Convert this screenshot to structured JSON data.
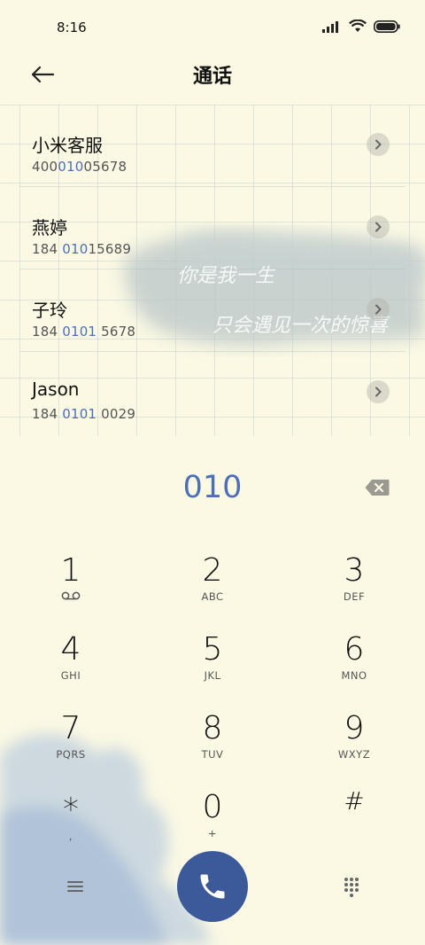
{
  "status_bar": {
    "time": "8:16"
  },
  "header": {
    "title": "通话"
  },
  "contacts": [
    {
      "name": "小米客服",
      "number_pre": "400",
      "number_hl": "010",
      "number_post": "05678"
    },
    {
      "name": "燕婷",
      "number_pre": "184 ",
      "number_hl": "010",
      "number_post": "15689"
    },
    {
      "name": "子玲",
      "number_pre": "184 ",
      "number_hl": "0101",
      "number_post": " 5678"
    },
    {
      "name": "Jason",
      "number_pre": "184 ",
      "number_hl": "0101",
      "number_post": " 0029"
    }
  ],
  "background_text": {
    "line1": "你是我一生",
    "line2": "只会遇见一次的惊喜"
  },
  "dialer": {
    "digits": "010"
  },
  "keypad": [
    {
      "num": "1",
      "sub": ""
    },
    {
      "num": "2",
      "sub": "ABC"
    },
    {
      "num": "3",
      "sub": "DEF"
    },
    {
      "num": "4",
      "sub": "GHI"
    },
    {
      "num": "5",
      "sub": "JKL"
    },
    {
      "num": "6",
      "sub": "MNO"
    },
    {
      "num": "7",
      "sub": "PQRS"
    },
    {
      "num": "8",
      "sub": "TUV"
    },
    {
      "num": "9",
      "sub": "WXYZ"
    },
    {
      "num": "*",
      "sub": ","
    },
    {
      "num": "0",
      "sub": "+"
    },
    {
      "num": "#",
      "sub": ""
    }
  ],
  "colors": {
    "accent": "#4e6fb8",
    "call_button": "#3c5a9a",
    "background": "#fbf9e4"
  },
  "icons": {
    "back": "arrow-left-icon",
    "chevron": "chevron-right-icon",
    "backspace": "backspace-icon",
    "voicemail": "voicemail-icon",
    "menu": "menu-icon",
    "call": "phone-icon",
    "dialpad": "dialpad-icon"
  }
}
